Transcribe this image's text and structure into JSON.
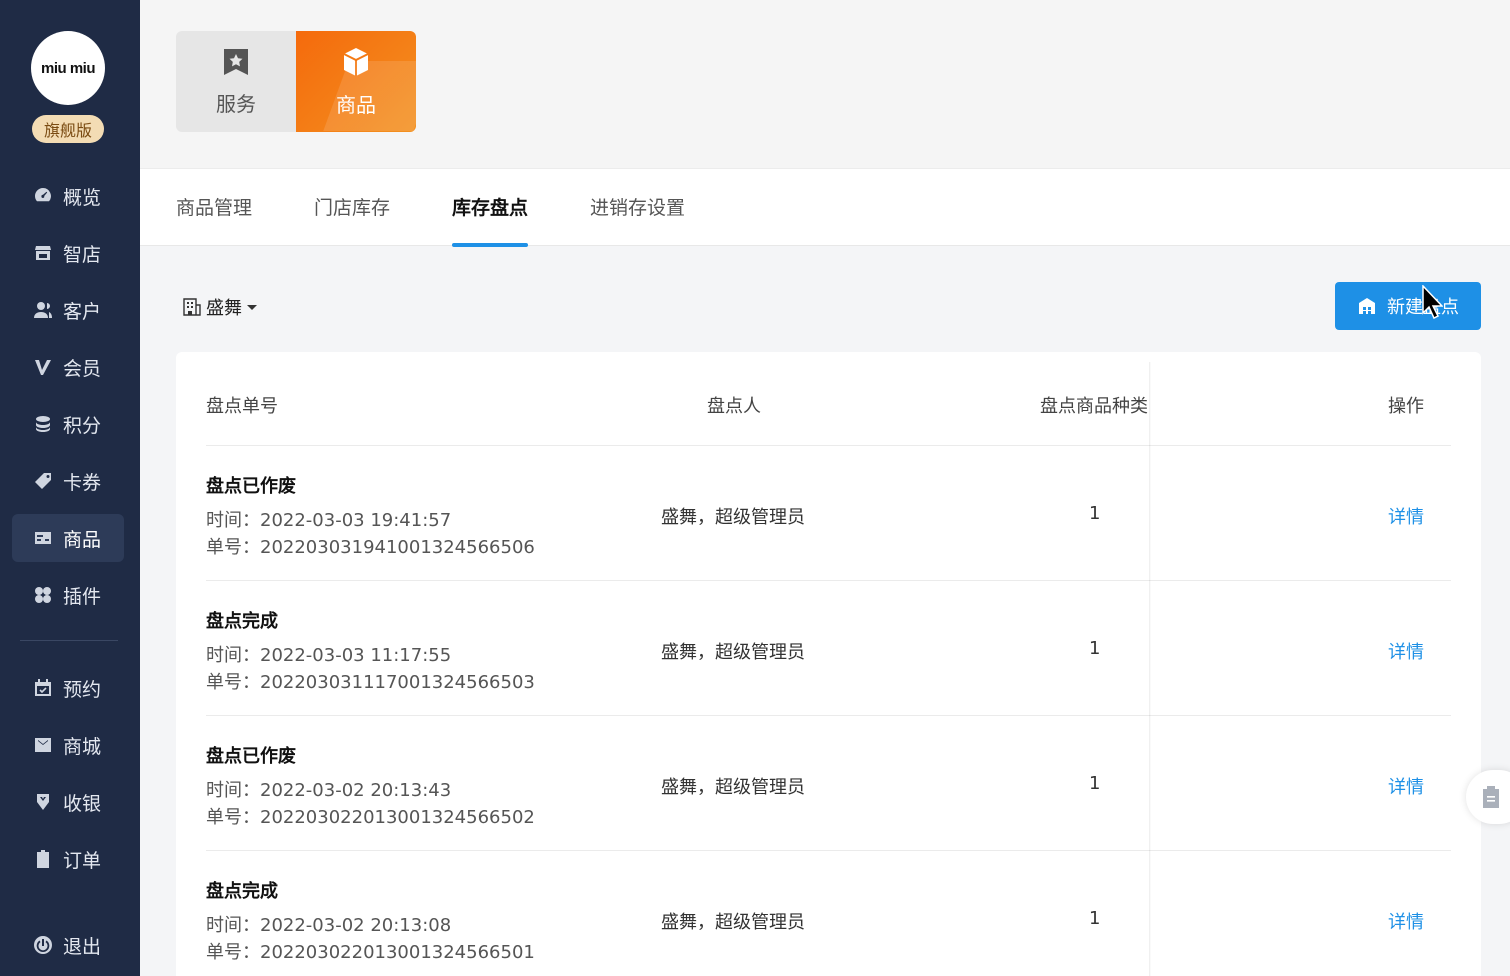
{
  "sidebar": {
    "logo_text": "miu miu",
    "badge": "旗舰版",
    "items": [
      {
        "label": "概览",
        "icon": "dashboard-icon"
      },
      {
        "label": "智店",
        "icon": "store-icon"
      },
      {
        "label": "客户",
        "icon": "customer-icon"
      },
      {
        "label": "会员",
        "icon": "vip-icon"
      },
      {
        "label": "积分",
        "icon": "points-icon"
      },
      {
        "label": "卡券",
        "icon": "coupon-icon"
      },
      {
        "label": "商品",
        "icon": "goods-icon",
        "active": true
      },
      {
        "label": "插件",
        "icon": "plugin-icon"
      },
      {
        "label": "预约",
        "icon": "calendar-icon"
      },
      {
        "label": "商城",
        "icon": "mall-icon"
      },
      {
        "label": "收银",
        "icon": "cashier-icon"
      },
      {
        "label": "订单",
        "icon": "order-icon"
      }
    ],
    "logout": "退出"
  },
  "categories": [
    {
      "label": "服务",
      "icon": "bookmark-star-icon"
    },
    {
      "label": "商品",
      "icon": "box-icon",
      "active": true
    }
  ],
  "tabs": [
    {
      "label": "商品管理"
    },
    {
      "label": "门店库存"
    },
    {
      "label": "库存盘点",
      "active": true
    },
    {
      "label": "进销存设置"
    }
  ],
  "store": {
    "name": "盛舞"
  },
  "new_button": "新建盘点",
  "table": {
    "headers": [
      "盘点单号",
      "盘点人",
      "盘点商品种类",
      "操作"
    ],
    "rows": [
      {
        "status": "盘点已作废",
        "time": "时间：2022-03-03 19:41:57",
        "number": "单号：2022030319410013245665​06",
        "person": "盛舞，超级管理员",
        "count": "1",
        "action": "详情"
      },
      {
        "status": "盘点完成",
        "time": "时间：2022-03-03 11:17:55",
        "number": "单号：202203031117001324566503",
        "person": "盛舞，超级管理员",
        "count": "1",
        "action": "详情"
      },
      {
        "status": "盘点已作废",
        "time": "时间：2022-03-02 20:13:43",
        "number": "单号：202203022013001324566502",
        "person": "盛舞，超级管理员",
        "count": "1",
        "action": "详情"
      },
      {
        "status": "盘点完成",
        "time": "时间：2022-03-02 20:13:08",
        "number": "单号：202203022013001324566501",
        "person": "盛舞，超级管理员",
        "count": "1",
        "action": "详情"
      }
    ]
  },
  "colors": {
    "sidebar": "#1f2b45",
    "accent": "#1e90e6",
    "goods_orange": "#f56a0c"
  }
}
